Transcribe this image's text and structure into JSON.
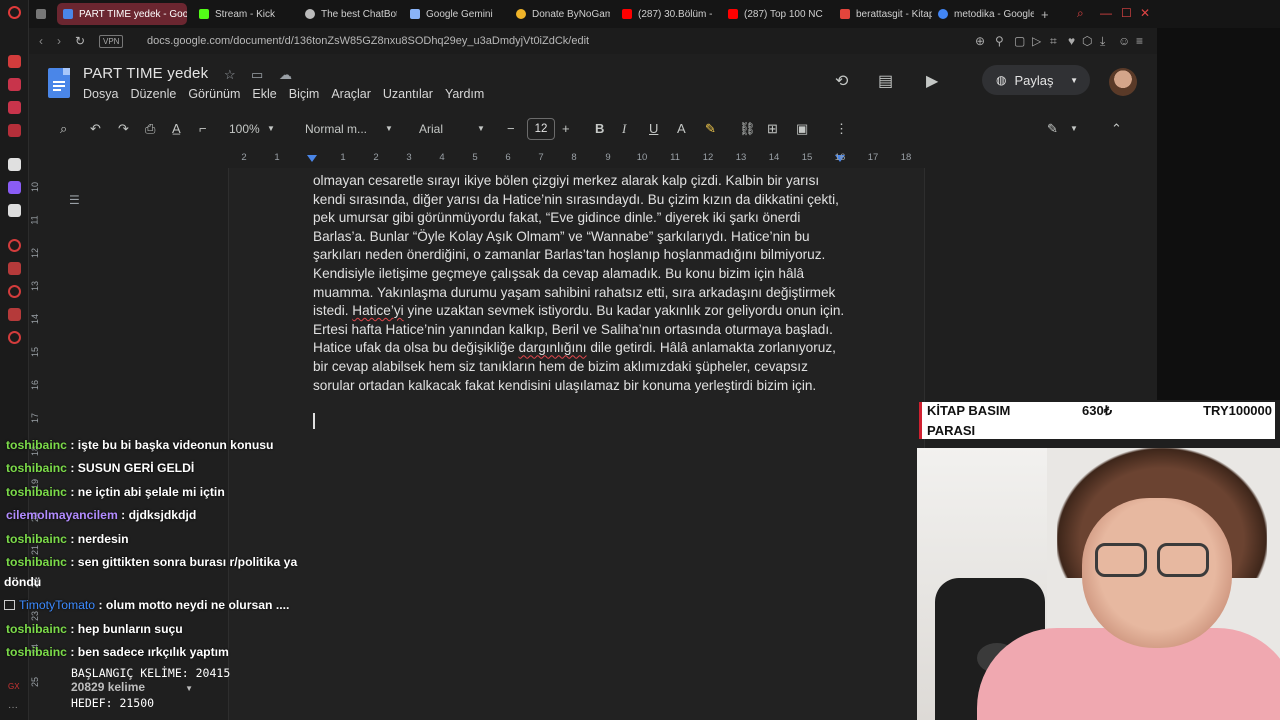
{
  "browser": {
    "tabs": [
      {
        "title": "PART TIME yedek - Goog",
        "active": true,
        "fav": "#4a86e8"
      },
      {
        "title": "Stream - Kick",
        "active": false,
        "fav": "#53fc18"
      },
      {
        "title": "The best ChatBot",
        "active": false,
        "fav": "#bbbbbb"
      },
      {
        "title": "Google Gemini",
        "active": false,
        "fav": "#8ab4f8"
      },
      {
        "title": "Donate ByNoGam",
        "active": false,
        "fav": "#f0b429"
      },
      {
        "title": "(287) 30.Bölüm -",
        "active": false,
        "fav": "#ff0000"
      },
      {
        "title": "(287) Top 100 NC",
        "active": false,
        "fav": "#ff0000"
      },
      {
        "title": "berattasgit - Kitap",
        "active": false,
        "fav": "#e2453c"
      },
      {
        "title": "metodika - Google",
        "active": false,
        "fav": "#4285f4"
      }
    ],
    "url": "docs.google.com/document/d/136tonZsW85GZ8nxu8SODhq29ey_u3aDmdyjVt0iZdCk/edit",
    "vpn_label": "VPN"
  },
  "doc": {
    "title": "PART TIME  yedek",
    "menu": [
      "Dosya",
      "Düzenle",
      "Görünüm",
      "Ekle",
      "Biçim",
      "Araçlar",
      "Uzantılar",
      "Yardım"
    ],
    "share_label": "Paylaş",
    "toolbar": {
      "zoom": "100%",
      "style": "Normal m...",
      "font": "Arial",
      "font_size": "12"
    },
    "ruler_numbers": [
      "2",
      "1",
      "1",
      "2",
      "3",
      "4",
      "5",
      "6",
      "7",
      "8",
      "9",
      "10",
      "11",
      "12",
      "13",
      "14",
      "15",
      "16",
      "17",
      "18"
    ],
    "vruler_numbers": [
      "10",
      "11",
      "12",
      "13",
      "14",
      "15",
      "16",
      "17",
      "18",
      "19",
      "20",
      "21",
      "22",
      "23",
      "24",
      "25"
    ],
    "paragraph": [
      {
        "t": "olmayan cesaretle sırayı ikiye bölen çizgiyi merkez alarak kalp çizdi. Kalbin bir yarısı kendi sırasında, diğer yarısı da Hatice’nin sırasındaydı. Bu çizim kızın da dikkatini çekti, pek umursar gibi görünmüyordu fakat, “Eve gidince dinle.” diyerek iki şarkı önerdi Barlas’a. Bunlar “Öyle Kolay Aşık Olmam” ve “Wannabe” şarkılarıydı. Hatice’nin bu şarkıları neden önerdiğini, o zamanlar Barlas’tan hoşlanıp hoşlanmadığını bilmiyoruz. Kendisiyle iletişime geçmeye çalışsak da cevap alamadık. Bu konu bizim için hâlâ muamma. Yakınlaşma durumu yaşam sahibini rahatsız etti, sıra arkadaşını değiştirmek istedi. "
      },
      {
        "t": "Hatice’yi",
        "spell": true
      },
      {
        "t": " yine uzaktan sevmek istiyordu. Bu kadar yakınlık zor geliyordu onun için. Ertesi hafta Hatice’nin yanından kalkıp, Beril ve Saliha’nın ortasında oturmaya başladı. Hatice ufak da olsa bu değişikliğe "
      },
      {
        "t": "dargınlığını",
        "spell": true
      },
      {
        "t": " dile getirdi. Hâlâ anlamakta zorlanıyoruz, bir cevap alabilsek hem siz tanıkların hem de bizim aklımızdaki şüpheler, cevapsız sorular ortadan kalkacak fakat kendisini ulaşılamaz bir konuma yerleştirdi bizim için."
      }
    ]
  },
  "chat": {
    "messages": [
      {
        "user": "toshibainc",
        "color": "#7cdb4a",
        "text": ": işte bu bi başka videonun konusu"
      },
      {
        "user": "toshibainc",
        "color": "#7cdb4a",
        "text": ": SUSUN GERİ GELDİ"
      },
      {
        "user": "toshibainc",
        "color": "#7cdb4a",
        "text": ": ne içtin abi şelale mi içtin"
      },
      {
        "user": "cilemolmayancilem",
        "color": "#b28cff",
        "text": ": djdksjdkdjd"
      },
      {
        "user": "toshibainc",
        "color": "#7cdb4a",
        "text": ": nerdesin"
      },
      {
        "user": "toshibainc",
        "color": "#7cdb4a",
        "text": ": sen gittikten sonra burası r/politika ya"
      },
      {
        "user": "TimotyTomato",
        "color": "#3d8bff",
        "text": ": olum motto neydi ne olursan ...."
      },
      {
        "user": "toshibainc",
        "color": "#7cdb4a",
        "text": ": hep bunların suçu"
      },
      {
        "user": "toshibainc",
        "color": "#7cdb4a",
        "text": ": ben sadece ırkçılık yaptım"
      }
    ],
    "continuation": "döndü"
  },
  "overlay": {
    "start_words": "BAŞLANGIÇ KELİME: 20415",
    "word_count": "20829 kelime",
    "target": "HEDEF: 21500",
    "kitap_line1": "KİTAP BASIM",
    "kitap_line2": "PARASI",
    "kitap_price": "630₺",
    "kitap_target": "TRY100000"
  },
  "colors": {
    "accent": "#4a86e8",
    "active_tab": "#6b2630",
    "kitap_border": "#d02030"
  }
}
